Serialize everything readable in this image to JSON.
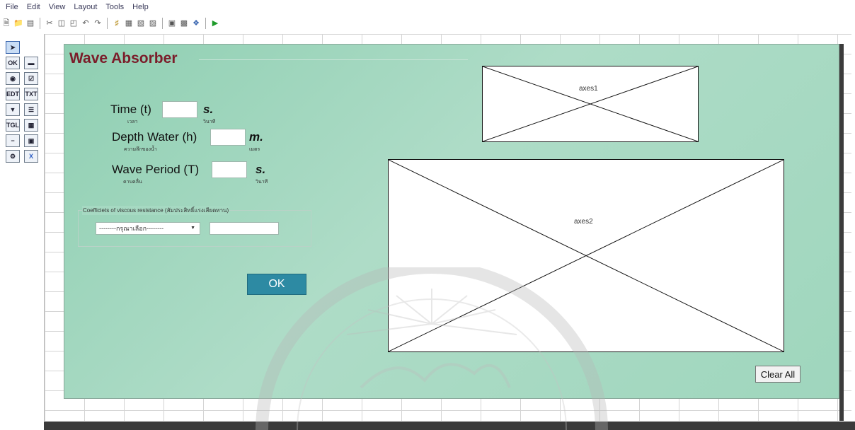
{
  "menu": [
    "File",
    "Edit",
    "View",
    "Layout",
    "Tools",
    "Help"
  ],
  "toolbar_icons": [
    "new-file-icon",
    "open-folder-icon",
    "save-icon",
    "cut-icon",
    "copy-icon",
    "paste-icon",
    "undo-icon",
    "redo-icon",
    "align-icon",
    "menu-editor-icon",
    "tab-order-icon",
    "toolbar-editor-icon",
    "m-file-editor-icon",
    "property-inspector-icon",
    "object-browser-icon",
    "run-icon"
  ],
  "palette_icons": [
    "select-icon",
    "push-button-icon",
    "slider-icon",
    "radio-button-icon",
    "checkbox-icon",
    "edit-text-icon",
    "static-text-icon",
    "popup-menu-icon",
    "listbox-icon",
    "toggle-button-icon",
    "table-icon",
    "axes-icon",
    "panel-icon",
    "button-group-icon",
    "activex-icon"
  ],
  "colors": {
    "title": "#7b1d2a",
    "panel_bg": "#9fd6bd",
    "ok_button": "#2d8aa3"
  },
  "figure": {
    "title": "Wave Absorber",
    "fields": [
      {
        "label": "Time (t)",
        "sub": "เวลา",
        "unit": "s.",
        "unit_sub": "วินาที"
      },
      {
        "label": "Depth Water (h)",
        "sub": "ความลึกของน้ำ",
        "unit": "m.",
        "unit_sub": "เมตร"
      },
      {
        "label": "Wave Period (T)",
        "sub": "คาบคลื่น",
        "unit": "s.",
        "unit_sub": "วินาที"
      }
    ],
    "group_title": "Coefficiets of viscous resistance (สัมประสิทธิ์แรงเสียดทาน)",
    "dropdown_value": "--------กรุณาเลือก--------",
    "ok_label": "OK",
    "clear_label": "Clear All",
    "axes1_label": "axes1",
    "axes2_label": "axes2"
  }
}
